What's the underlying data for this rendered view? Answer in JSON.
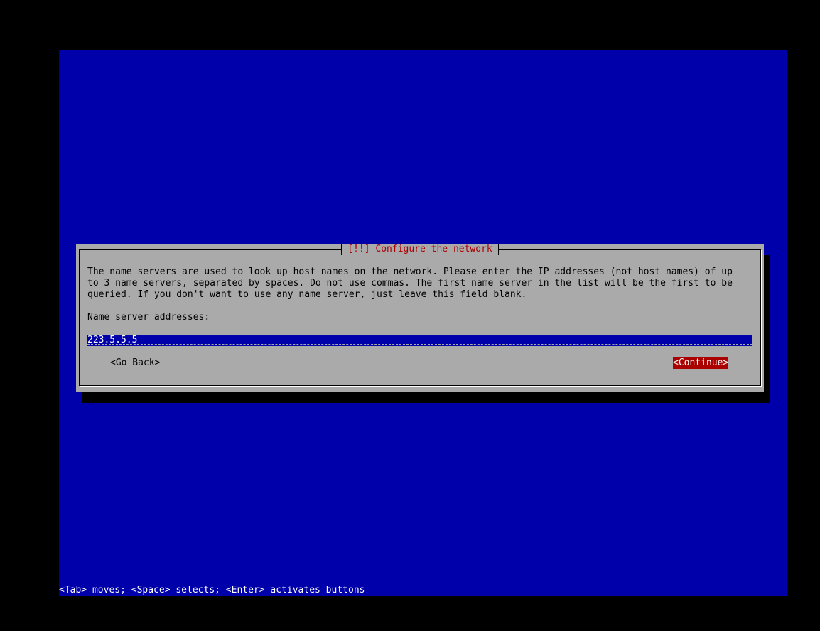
{
  "dialog": {
    "title": "[!!] Configure the network",
    "description_lines": [
      "The name servers are used to look up host names on the network. Please enter the IP addresses (not host names) of up",
      "to 3 name servers, separated by spaces. Do not use commas. The first name server in the list will be the first to be",
      "queried. If you don't want to use any name server, just leave this field blank."
    ],
    "field_label": "Name server addresses:",
    "field_value": "223.5.5.5",
    "go_back_label": "<Go Back>",
    "continue_label": "<Continue>"
  },
  "status_bar": {
    "help_text": "<Tab> moves; <Space> selects; <Enter> activates buttons"
  },
  "colors": {
    "background": "#0000aa",
    "dialog": "#aaaaaa",
    "title": "#aa0000",
    "selected_button": "#aa0000"
  }
}
